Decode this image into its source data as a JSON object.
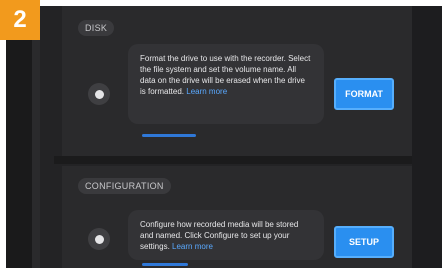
{
  "step_badge": "2",
  "sections": [
    {
      "header": "DISK",
      "description": "Format the drive to use with the recorder. Select the file system and set the volume name. All data on the drive will be erased when the drive is formatted.",
      "link_text": "Learn more",
      "button_label": "FORMAT"
    },
    {
      "header": "CONFIGURATION",
      "description": "Configure how recorded media will be stored and named. Click Configure to set up your settings.",
      "link_text": "Learn more",
      "button_label": "SETUP"
    }
  ],
  "colors": {
    "accent": "#2a8ff0",
    "badge": "#f29a1d",
    "background": "#232325"
  }
}
